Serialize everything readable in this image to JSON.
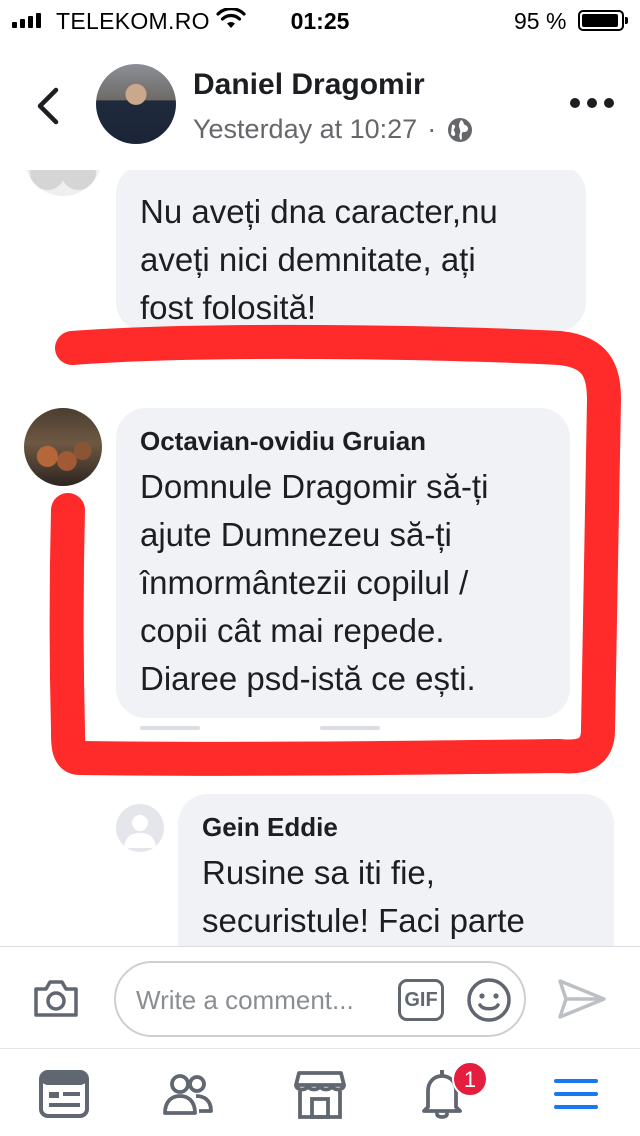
{
  "status_bar": {
    "carrier": "TELEKOM.RO",
    "time": "01:25",
    "battery_percent": "95 %",
    "battery_level": 0.95
  },
  "header": {
    "name": "Daniel Dragomir",
    "timestamp": "Yesterday at 10:27",
    "separator": "·",
    "privacy_icon": "globe-icon"
  },
  "comments": [
    {
      "author": "",
      "text": "Nu aveți dna caracter,nu\naveți nici demnitate, ați\nfost folosită!"
    },
    {
      "author": "Octavian-ovidiu Gruian",
      "text": "Domnule Dragomir să-ți\najute Dumnezeu să-ți\nînmormântezii copilul /\ncopii cât mai repede.\nDiaree psd-istă ce ești."
    },
    {
      "author": "Gein Eddie",
      "text": "Rusine sa iti fie,\nsecuristule! Faci  parte"
    }
  ],
  "composer": {
    "placeholder": "Write a comment...",
    "gif_label": "GIF"
  },
  "bottom_nav": {
    "notifications_badge": "1",
    "items": [
      "news-feed-icon",
      "friends-icon",
      "marketplace-icon",
      "notifications-icon",
      "menu-icon"
    ]
  },
  "colors": {
    "bubble_bg": "#f0f2f5",
    "highlight_red": "#ff2a2a",
    "accent_blue": "#1877f2",
    "badge_red": "#e41e3f"
  }
}
